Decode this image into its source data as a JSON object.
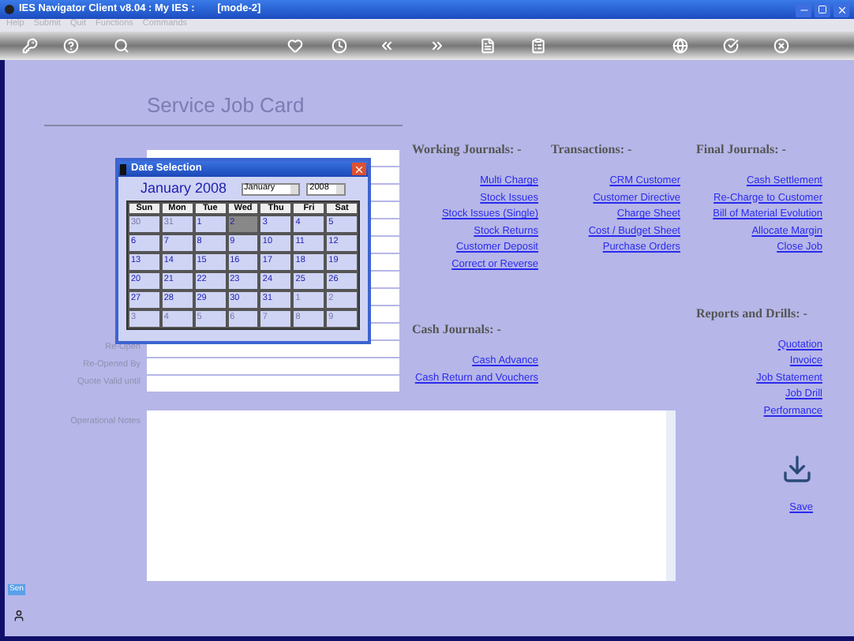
{
  "window": {
    "title": "IES Navigator Client v8.04 : My IES :        [mode-2]"
  },
  "menu": [
    "Help",
    "Submit",
    "Quit",
    "Functions",
    "Commands"
  ],
  "form": {
    "title": "Service Job Card",
    "fields": [
      {
        "label": "Re-Open"
      },
      {
        "label": "Re-Opened By"
      },
      {
        "label": "Quote Valid until"
      }
    ],
    "notes_label": "Operational Notes"
  },
  "calendar": {
    "title": "Date Selection",
    "heading": "January 2008",
    "month": "January",
    "year": "2008",
    "weekdays": [
      "Sun",
      "Mon",
      "Tue",
      "Wed",
      "Thu",
      "Fri",
      "Sat"
    ],
    "days": [
      {
        "label": "30",
        "kind": "other",
        "selected": false
      },
      {
        "label": "31",
        "kind": "other",
        "selected": false
      },
      {
        "label": "1",
        "kind": "current",
        "selected": false
      },
      {
        "label": "2",
        "kind": "current",
        "selected": true
      },
      {
        "label": "3",
        "kind": "current",
        "selected": false
      },
      {
        "label": "4",
        "kind": "current",
        "selected": false
      },
      {
        "label": "5",
        "kind": "current",
        "selected": false
      },
      {
        "label": "6",
        "kind": "current",
        "selected": false
      },
      {
        "label": "7",
        "kind": "current",
        "selected": false
      },
      {
        "label": "8",
        "kind": "current",
        "selected": false
      },
      {
        "label": "9",
        "kind": "current",
        "selected": false
      },
      {
        "label": "10",
        "kind": "current",
        "selected": false
      },
      {
        "label": "11",
        "kind": "current",
        "selected": false
      },
      {
        "label": "12",
        "kind": "current",
        "selected": false
      },
      {
        "label": "13",
        "kind": "current",
        "selected": false
      },
      {
        "label": "14",
        "kind": "current",
        "selected": false
      },
      {
        "label": "15",
        "kind": "current",
        "selected": false
      },
      {
        "label": "16",
        "kind": "current",
        "selected": false
      },
      {
        "label": "17",
        "kind": "current",
        "selected": false
      },
      {
        "label": "18",
        "kind": "current",
        "selected": false
      },
      {
        "label": "19",
        "kind": "current",
        "selected": false
      },
      {
        "label": "20",
        "kind": "current",
        "selected": false
      },
      {
        "label": "21",
        "kind": "current",
        "selected": false
      },
      {
        "label": "22",
        "kind": "current",
        "selected": false
      },
      {
        "label": "23",
        "kind": "current",
        "selected": false
      },
      {
        "label": "24",
        "kind": "current",
        "selected": false
      },
      {
        "label": "25",
        "kind": "current",
        "selected": false
      },
      {
        "label": "26",
        "kind": "current",
        "selected": false
      },
      {
        "label": "27",
        "kind": "current",
        "selected": false
      },
      {
        "label": "28",
        "kind": "current",
        "selected": false
      },
      {
        "label": "29",
        "kind": "current",
        "selected": false
      },
      {
        "label": "30",
        "kind": "current",
        "selected": false
      },
      {
        "label": "31",
        "kind": "current",
        "selected": false
      },
      {
        "label": "1",
        "kind": "other",
        "selected": false
      },
      {
        "label": "2",
        "kind": "other",
        "selected": false
      },
      {
        "label": "3",
        "kind": "other",
        "selected": false
      },
      {
        "label": "4",
        "kind": "other",
        "selected": false
      },
      {
        "label": "5",
        "kind": "other",
        "selected": false
      },
      {
        "label": "6",
        "kind": "other",
        "selected": false
      },
      {
        "label": "7",
        "kind": "other",
        "selected": false
      },
      {
        "label": "8",
        "kind": "other",
        "selected": false
      },
      {
        "label": "9",
        "kind": "other",
        "selected": false
      }
    ]
  },
  "working_journals": {
    "title": "Working Journals: -",
    "links": [
      "Multi Charge",
      "Stock Issues",
      "Stock Issues (Single)",
      "Stock Returns",
      "Customer Deposit",
      "Correct or Reverse"
    ]
  },
  "transactions": {
    "title": "Transactions: -",
    "links": [
      "CRM Customer",
      "Customer Directive",
      "Charge Sheet",
      "Cost / Budget Sheet",
      "Purchase Orders"
    ]
  },
  "final_journals": {
    "title": "Final Journals: -",
    "links": [
      "Cash Settlement",
      "Re-Charge to Customer",
      "Bill of Material Evolution",
      "Allocate Margin",
      "Close Job"
    ]
  },
  "cash_journals": {
    "title": "Cash Journals: -",
    "links": [
      "Cash Advance",
      "Cash Return and Vouchers"
    ]
  },
  "reports": {
    "title": "Reports and Drills: -",
    "links": [
      "Quotation",
      "Invoice",
      "Job Statement",
      "Job Drill",
      "Performance"
    ]
  },
  "save": {
    "label": "Save"
  },
  "side_tab": {
    "label": "Sen"
  }
}
